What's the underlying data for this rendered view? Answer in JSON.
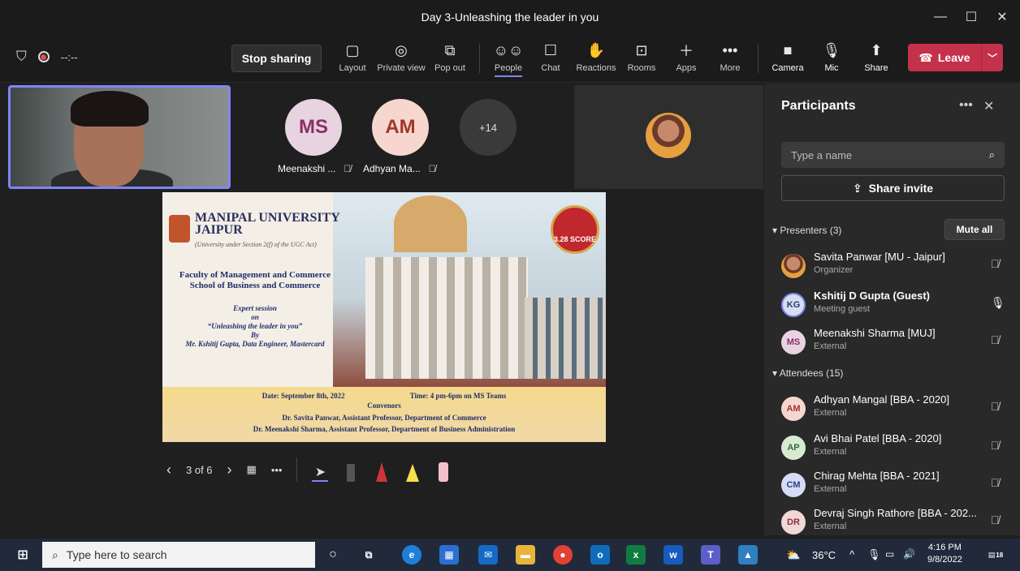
{
  "window": {
    "title": "Day 3-Unleashing the leader in you",
    "controls": [
      "—",
      "☐",
      "✕"
    ]
  },
  "toolbar": {
    "timer": "--:--",
    "stop_sharing": "Stop sharing",
    "buttons": [
      {
        "label": "Layout",
        "icon": "layout-icon"
      },
      {
        "label": "Private view",
        "icon": "eye-icon"
      },
      {
        "label": "Pop out",
        "icon": "popout-icon"
      },
      {
        "label": "People",
        "icon": "people-icon"
      },
      {
        "label": "Chat",
        "icon": "chat-icon"
      },
      {
        "label": "Reactions",
        "icon": "reactions-icon"
      },
      {
        "label": "Rooms",
        "icon": "rooms-icon"
      },
      {
        "label": "Apps",
        "icon": "plus-icon"
      },
      {
        "label": "More",
        "icon": "more-icon"
      },
      {
        "label": "Camera",
        "icon": "camera-off-icon"
      },
      {
        "label": "Mic",
        "icon": "mic-off-icon"
      },
      {
        "label": "Share",
        "icon": "share-icon"
      }
    ],
    "leave": "Leave",
    "accent": "#7f85f5",
    "leave_color": "#c4314b"
  },
  "stage": {
    "tiles": [
      {
        "initials": "MS",
        "name": "Meenakshi ...",
        "bg": "#e8d3e0",
        "fg": "#8d2f6a"
      },
      {
        "initials": "AM",
        "name": "Adhyan Ma...",
        "bg": "#f7d6cf",
        "fg": "#a0362a"
      }
    ],
    "overflow": "+14",
    "slide": {
      "university": "MANIPAL UNIVERSITY",
      "city": "JAIPUR",
      "university_sub": "(University under Section 2(f) of the UGC Act)",
      "faculty": "Faculty of Management and Commerce",
      "school": "School of Business and Commerce",
      "session": "Expert session",
      "on": "on",
      "topic": "“Unleashing the leader in you”",
      "by": "By",
      "speaker": "Mr. Kshitij Gupta, Data Engineer, Mastercard",
      "date": "Date: September 8th, 2022",
      "time": "Time: 4 pm-6pm on MS Teams",
      "convenors": "Convenors",
      "convenor1": "Dr. Savita Panwar, Assistant Professor, Department of Commerce",
      "convenor2": "Dr. Meenakshi Sharma, Assistant Professor, Department of Business Administration",
      "badge_text": "3.28 SCORE"
    },
    "pager": "3 of 6"
  },
  "panel": {
    "title": "Participants",
    "search_placeholder": "Type a name",
    "invite": "Share invite",
    "presenters_label": "Presenters (3)",
    "mute_all": "Mute all",
    "attendees_label": "Attendees (15)",
    "presenters": [
      {
        "initials": "",
        "name": "Savita Panwar [MU - Jaipur]",
        "role": "Organizer",
        "bg": "#c68a6a",
        "fg": "#fff",
        "mic": "muted"
      },
      {
        "initials": "KG",
        "name": "Kshitij D Gupta (Guest)",
        "role": "Meeting guest",
        "bg": "#d7def0",
        "fg": "#2b3a6b",
        "mic": "on"
      },
      {
        "initials": "MS",
        "name": "Meenakshi Sharma [MUJ]",
        "role": "External",
        "bg": "#e8d3e0",
        "fg": "#8d2f6a",
        "mic": "muted"
      }
    ],
    "attendees": [
      {
        "initials": "AM",
        "name": "Adhyan Mangal [BBA - 2020]",
        "role": "External",
        "bg": "#f7d6cf",
        "fg": "#a0362a"
      },
      {
        "initials": "AP",
        "name": "Avi Bhai Patel [BBA - 2020]",
        "role": "External",
        "bg": "#d9ead3",
        "fg": "#2e6b3a"
      },
      {
        "initials": "CM",
        "name": "Chirag Mehta [BBA - 2021]",
        "role": "External",
        "bg": "#d6dcf5",
        "fg": "#2f3d8d"
      },
      {
        "initials": "DR",
        "name": "Devraj Singh Rathore [BBA - 202...",
        "role": "External",
        "bg": "#f2d7d9",
        "fg": "#8d2f3a"
      }
    ]
  },
  "taskbar": {
    "search_placeholder": "Type here to search",
    "weather": "36°C",
    "time": "4:16 PM",
    "date": "9/8/2022",
    "notifications": "18"
  }
}
